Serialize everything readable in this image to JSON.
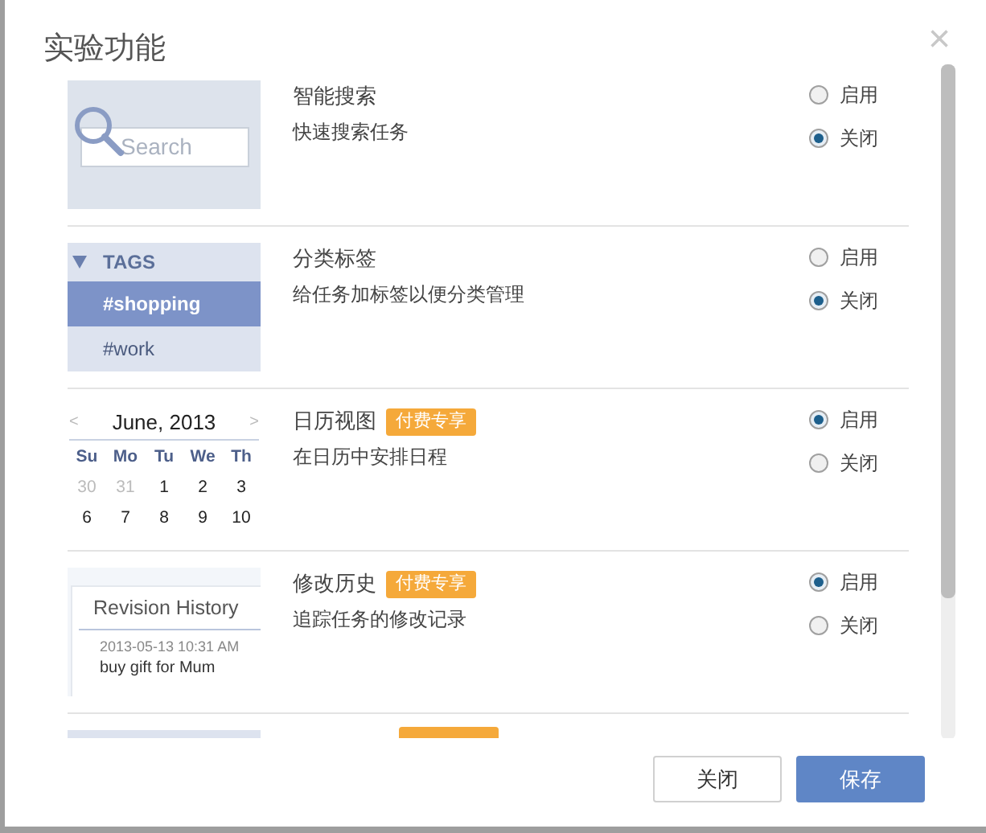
{
  "dialog": {
    "title": "实验功能",
    "close": "×"
  },
  "features": [
    {
      "thumb": {
        "kind": "search",
        "placeholder": "Search"
      },
      "name": "智能搜索",
      "description": "快速搜索任务",
      "options": [
        {
          "label": "启用",
          "selected": false
        },
        {
          "label": "关闭",
          "selected": true
        }
      ]
    },
    {
      "thumb": {
        "kind": "tags",
        "header": "TAGS",
        "tags": [
          {
            "label": "#shopping",
            "selected": true
          },
          {
            "label": "#work",
            "selected": false
          }
        ]
      },
      "name": "分类标签",
      "description": "给任务加标签以便分类管理",
      "options": [
        {
          "label": "启用",
          "selected": false
        },
        {
          "label": "关闭",
          "selected": true
        }
      ]
    },
    {
      "thumb": {
        "kind": "calendar",
        "prev": "<",
        "month": "June, 2013",
        "next": ">",
        "weekdays": [
          "Su",
          "Mo",
          "Tu",
          "We",
          "Th"
        ],
        "days": [
          {
            "label": "30",
            "muted": true
          },
          {
            "label": "31",
            "muted": true
          },
          {
            "label": "1",
            "muted": false
          },
          {
            "label": "2",
            "muted": false
          },
          {
            "label": "3",
            "muted": false
          },
          {
            "label": "6",
            "muted": false
          },
          {
            "label": "7",
            "muted": false
          },
          {
            "label": "8",
            "muted": false
          },
          {
            "label": "9",
            "muted": false
          },
          {
            "label": "10",
            "muted": false
          }
        ]
      },
      "name": "日历视图",
      "badge": "付费专享",
      "description": "在日历中安排日程",
      "options": [
        {
          "label": "启用",
          "selected": true
        },
        {
          "label": "关闭",
          "selected": false
        }
      ]
    },
    {
      "thumb": {
        "kind": "revision",
        "title": "Revision History",
        "date": "2013-05-13 10:31 AM",
        "entry": "buy gift for Mum"
      },
      "name": "修改历史",
      "badge": "付费专享",
      "description": "追踪任务的修改记录",
      "options": [
        {
          "label": "启用",
          "selected": true
        },
        {
          "label": "关闭",
          "selected": false
        }
      ]
    },
    {
      "thumb": {
        "kind": "partial"
      }
    }
  ],
  "buttons": [
    {
      "label": "关闭",
      "kind": "secondary"
    },
    {
      "label": "保存",
      "kind": "primary"
    }
  ]
}
